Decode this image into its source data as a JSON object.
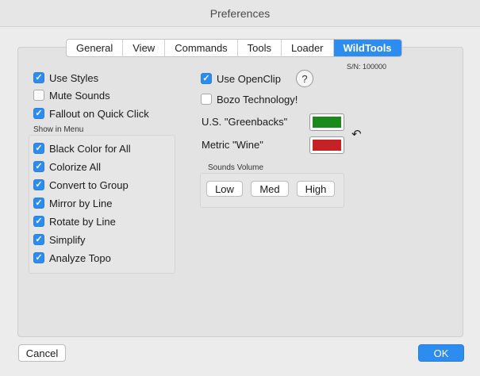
{
  "window": {
    "title": "Preferences"
  },
  "tabs": [
    {
      "label": "General",
      "active": false
    },
    {
      "label": "View",
      "active": false
    },
    {
      "label": "Commands",
      "active": false
    },
    {
      "label": "Tools",
      "active": false
    },
    {
      "label": "Loader",
      "active": false
    },
    {
      "label": "WildTools",
      "active": true
    }
  ],
  "serial": "S/N: 100000",
  "options": [
    {
      "label": "Use Styles",
      "checked": true
    },
    {
      "label": "Mute Sounds",
      "checked": false
    },
    {
      "label": "Fallout on Quick Click",
      "checked": true
    }
  ],
  "show_in_menu": {
    "label": "Show in Menu",
    "items": [
      {
        "label": "Black Color for All",
        "checked": true
      },
      {
        "label": "Colorize All",
        "checked": true
      },
      {
        "label": "Convert to Group",
        "checked": true
      },
      {
        "label": "Mirror by Line",
        "checked": true
      },
      {
        "label": "Rotate by Line",
        "checked": true
      },
      {
        "label": "Simplify",
        "checked": true
      },
      {
        "label": "Analyze Topo",
        "checked": true
      }
    ]
  },
  "right_options": [
    {
      "label": "Use OpenClip",
      "checked": true
    },
    {
      "label": "Bozo Technology!",
      "checked": false
    }
  ],
  "help_label": "?",
  "colors": {
    "greenbacks": {
      "label": "U.S. \"Greenbacks\"",
      "color": "#1a8a1a"
    },
    "wine": {
      "label": "Metric \"Wine\"",
      "color": "#c42226"
    }
  },
  "undo_icon": "↶",
  "sounds_volume": {
    "label": "Sounds Volume",
    "buttons": [
      "Low",
      "Med",
      "High"
    ]
  },
  "footer": {
    "cancel": "Cancel",
    "ok": "OK"
  }
}
